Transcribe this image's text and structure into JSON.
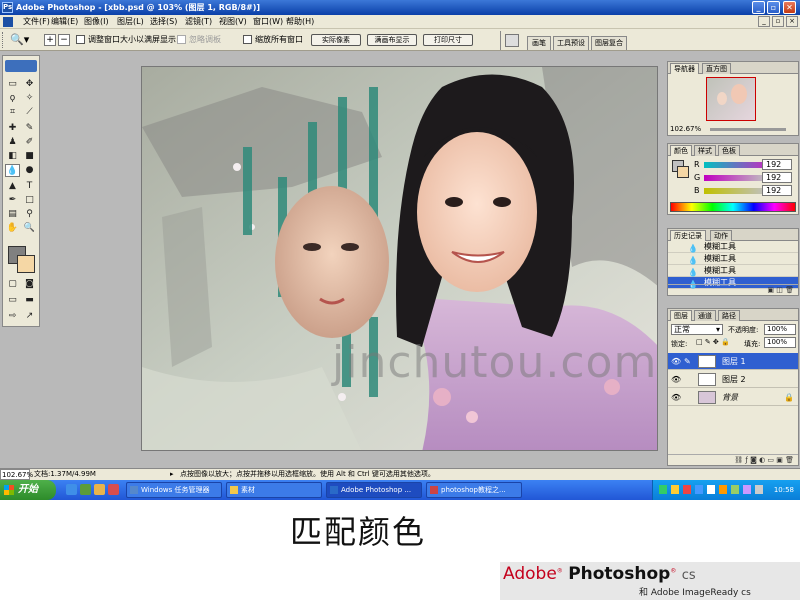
{
  "window": {
    "title": "Adobe Photoshop - [xbb.psd @ 103% (图层 1, RGB/8#)]",
    "min": "_",
    "restore": "▫",
    "close": "✕"
  },
  "menus": [
    "文件(F)",
    "编辑(E)",
    "图像(I)",
    "图层(L)",
    "选择(S)",
    "滤镜(T)",
    "视图(V)",
    "窗口(W)",
    "帮助(H)"
  ],
  "options": {
    "checkbox1_label": "调整窗口大小以满屏显示",
    "ignore_palettes_label": "忽略调板",
    "checkbox2_label": "缩放所有窗口",
    "btn_actual": "实际像素",
    "btn_fit": "满画布显示",
    "btn_print": "打印尺寸",
    "palette_tabs": [
      "画笔",
      "工具预设",
      "图层复合"
    ]
  },
  "navigator": {
    "tabs": [
      "导航器",
      "直方图"
    ],
    "zoom": "102.67%"
  },
  "color_panel": {
    "tabs": [
      "颜色",
      "样式",
      "色板"
    ],
    "channels": [
      {
        "label": "R",
        "value": "192"
      },
      {
        "label": "G",
        "value": "192"
      },
      {
        "label": "B",
        "value": "192"
      }
    ],
    "foreground": "#c0c0c0",
    "background": "#f5d7a5"
  },
  "history": {
    "tabs": [
      "历史记录",
      "动作"
    ],
    "items": [
      "模糊工具",
      "模糊工具",
      "模糊工具",
      "模糊工具"
    ]
  },
  "layers": {
    "tabs": [
      "图层",
      "通道",
      "路径"
    ],
    "blend_mode": "正常",
    "opacity_label": "不透明度:",
    "opacity": "100%",
    "lock_label": "锁定:",
    "fill_label": "填充:",
    "fill": "100%",
    "rows": [
      {
        "name": "图层 1"
      },
      {
        "name": "图层 2"
      },
      {
        "name": "背景"
      }
    ]
  },
  "status": {
    "zoom": "102.67%",
    "doc": "文档:1.37M/4.99M",
    "hint": "点按图像以放大；点按并拖移以用选框缩放。使用 Alt 和 Ctrl 键可选用其他选项。"
  },
  "canvas": {
    "watermark": "jinchutou.com"
  },
  "taskbar": {
    "start": "开始",
    "tasks": [
      "Windows 任务管理器",
      "素材",
      "Adobe Photoshop ...",
      "photoshop教程之..."
    ],
    "clock": "10:58"
  },
  "slide": {
    "caption": "匹配颜色",
    "brand_main_1": "Adobe",
    "brand_main_2": "Photoshop",
    "brand_main_3": "cs",
    "brand_sub": "和 Adobe ImageReady cs"
  }
}
